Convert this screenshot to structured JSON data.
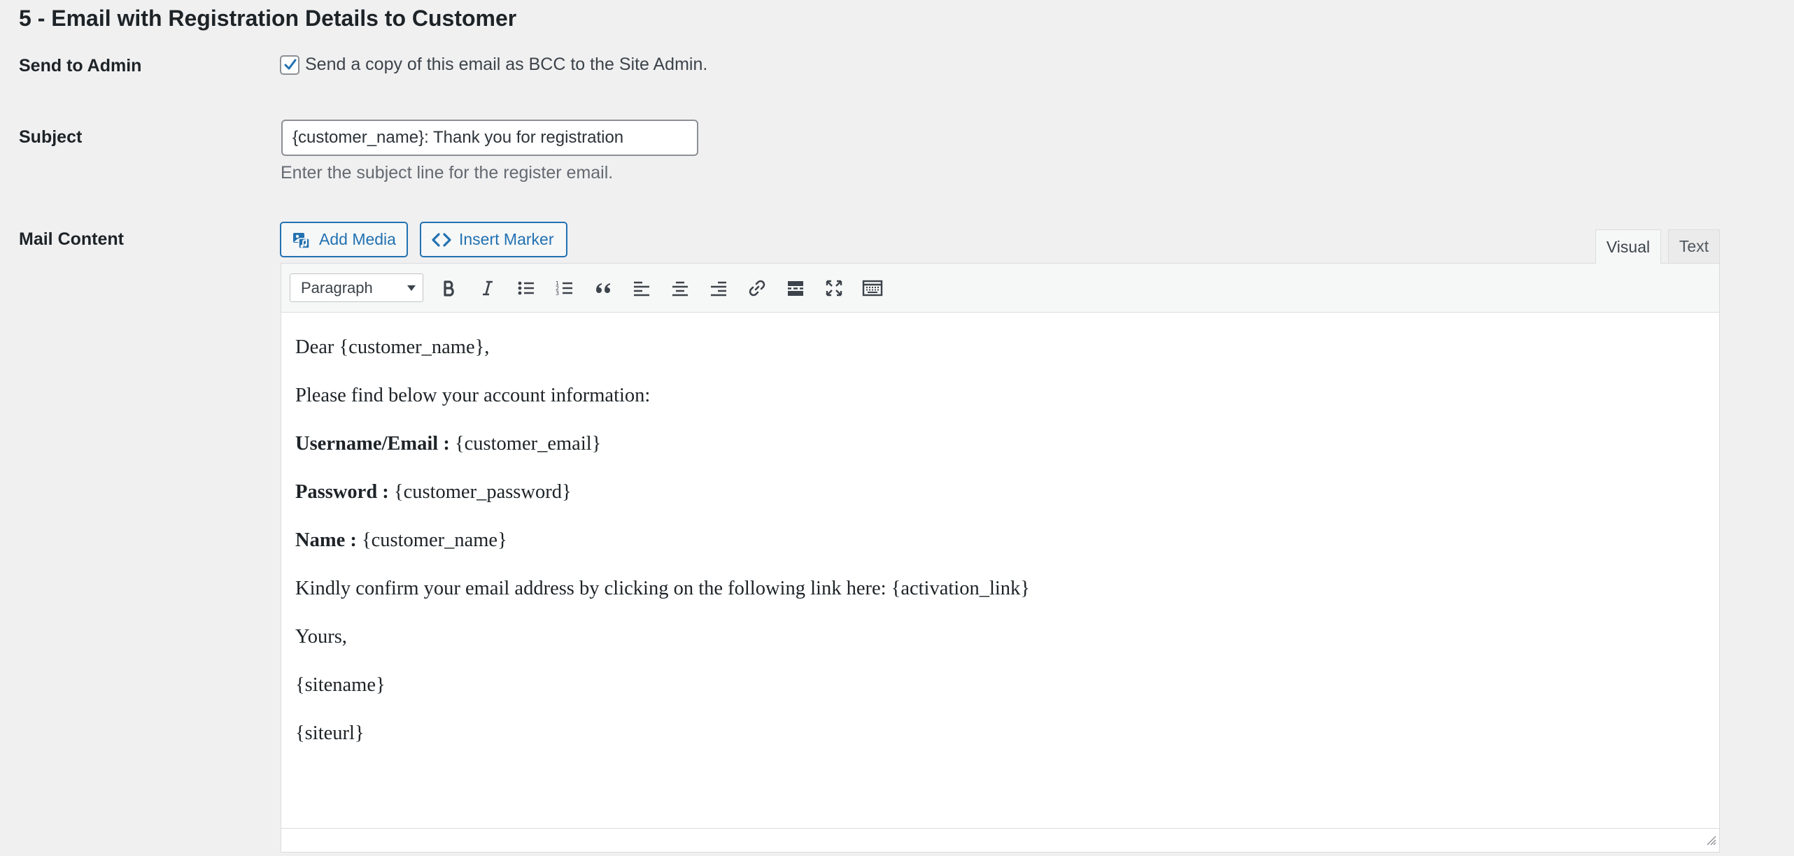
{
  "section": {
    "title": "5 - Email with Registration Details to Customer"
  },
  "send_to_admin": {
    "label": "Send to Admin",
    "checked": true,
    "checkbox_text": "Send a copy of this email as BCC to the Site Admin."
  },
  "subject": {
    "label": "Subject",
    "value": "{customer_name}: Thank you for registration",
    "description": "Enter the subject line for the register email."
  },
  "mail_content": {
    "label": "Mail Content",
    "buttons": {
      "add_media": "Add Media",
      "insert_marker": "Insert Marker"
    },
    "tabs": {
      "visual": "Visual",
      "text": "Text",
      "active": "Visual"
    },
    "toolbar": {
      "format_select": "Paragraph",
      "icons": [
        "bold-icon",
        "italic-icon",
        "bulleted-list-icon",
        "numbered-list-icon",
        "blockquote-icon",
        "align-left-icon",
        "align-center-icon",
        "align-right-icon",
        "link-icon",
        "read-more-icon",
        "fullscreen-icon",
        "toolbar-toggle-icon"
      ]
    },
    "body": {
      "greeting": "Dear {customer_name},",
      "intro": "Please find below your account information:",
      "username_label": "Username/Email :",
      "username_value": " {customer_email}",
      "password_label": "Password :",
      "password_value": " {customer_password}",
      "name_label": "Name :",
      "name_value": " {customer_name}",
      "confirm": "Kindly confirm your email address by clicking on the following link here: {activation_link}",
      "closing": "Yours,",
      "sitename": "{sitename}",
      "siteurl": "{siteurl}"
    }
  },
  "colors": {
    "background": "#f0f0f1",
    "accent": "#2271b1",
    "text": "#1d2327",
    "muted": "#646970"
  }
}
